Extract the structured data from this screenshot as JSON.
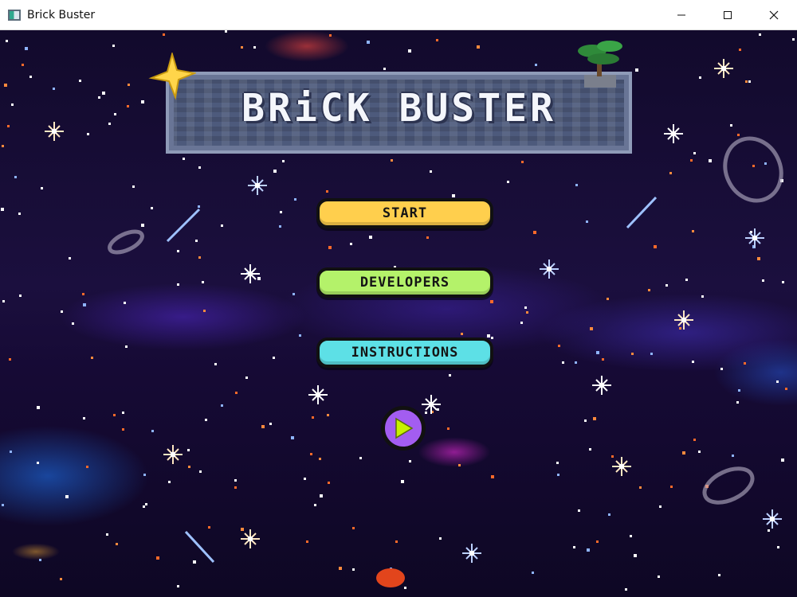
{
  "window": {
    "title": "Brick Buster",
    "controls": [
      "minimize",
      "maximize",
      "close"
    ]
  },
  "game": {
    "logo_text": "BRiCK BUSTER",
    "menu": {
      "start_label": "START",
      "developers_label": "DEVELOPERS",
      "instructions_label": "INSTRUCTIONS"
    },
    "play_icon": "play-icon"
  },
  "colors": {
    "start_button": "#ffcf4d",
    "developers_button": "#b4f26a",
    "instructions_button": "#5de0e6",
    "play_button": "#a35df0",
    "play_triangle": "#c7f000",
    "logo_stone": "#4d5a7c",
    "background": "#120a2c"
  }
}
